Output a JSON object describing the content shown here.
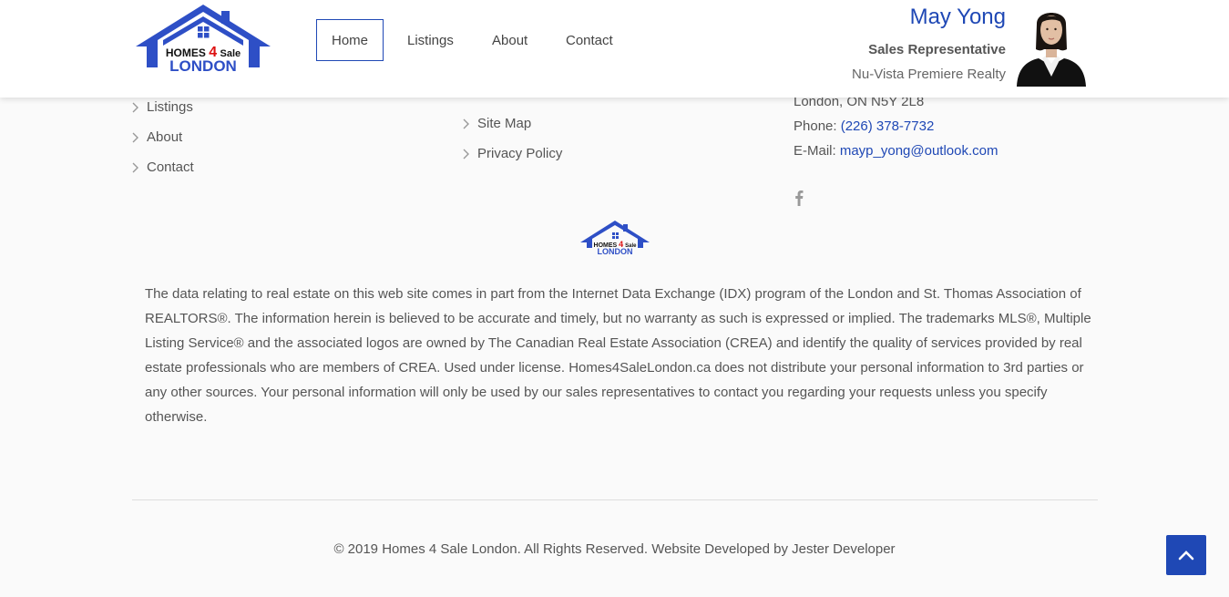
{
  "header": {
    "logo_line1": "HOMES",
    "logo_four": "4",
    "logo_sale": "Sale",
    "logo_line2": "LONDON",
    "nav": [
      {
        "label": "Home"
      },
      {
        "label": "Listings"
      },
      {
        "label": "About"
      },
      {
        "label": "Contact"
      }
    ],
    "agent": {
      "name": "May Yong",
      "title": "Sales Representative",
      "company": "Nu-Vista Premiere Realty"
    }
  },
  "footer": {
    "quick_links": [
      {
        "label": "Listings"
      },
      {
        "label": "About"
      },
      {
        "label": "Contact"
      }
    ],
    "more_links": [
      {
        "label": "Site Map"
      },
      {
        "label": "Privacy Policy"
      }
    ],
    "contact": {
      "address": "London, ON N5Y 2L8",
      "phone_label": "Phone: ",
      "phone": "(226) 378-7732",
      "email_label": "E-Mail: ",
      "email": "mayp_yong@outlook.com"
    },
    "social": [
      "facebook-icon"
    ],
    "disclaimer": "The data relating to real estate on this web site comes in part from the Internet Data Exchange (IDX) program of the London and St. Thomas Association of REALTORS®. The information herein is believed to be accurate and timely, but no warranty as such is expressed or implied. The trademarks MLS®, Multiple Listing Service® and the associated logos are owned by The Canadian Real Estate Association (CREA) and identify the quality of services provided by real estate professionals who are members of CREA. Used under license. Homes4SaleLondon.ca does not distribute your personal information to 3rd parties or any other sources. Your personal information will only be used by our sales representatives to contact you regarding your requests unless you specify otherwise.",
    "copyright": "© 2019 Homes 4 Sale London. All Rights Reserved. Website Developed by Jester Developer"
  },
  "colors": {
    "brand_blue": "#1f48b5",
    "text": "#555555",
    "background": "#fafafa"
  }
}
